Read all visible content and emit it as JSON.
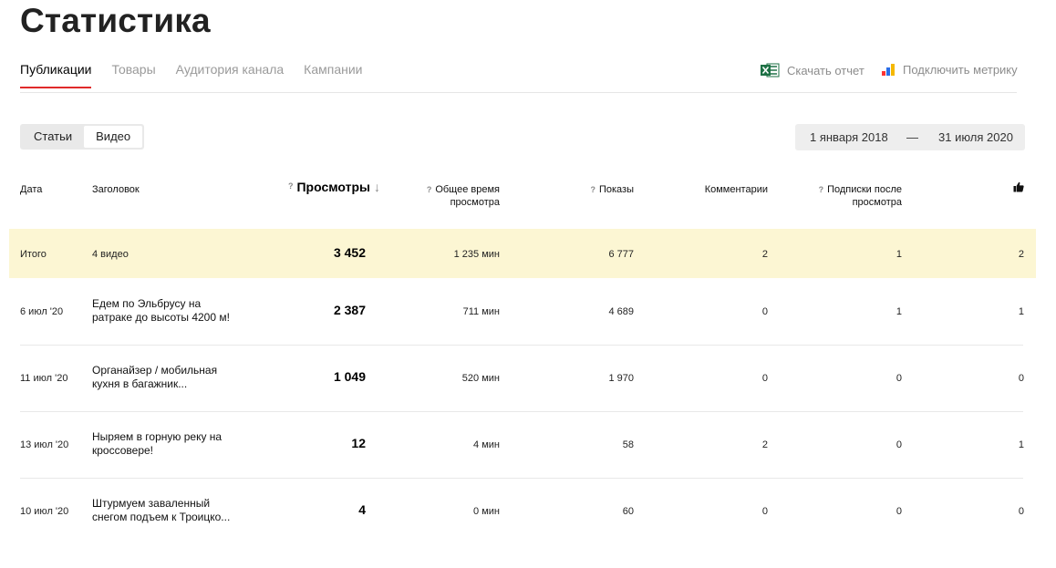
{
  "page_title": "Статистика",
  "tabs": [
    {
      "label": "Публикации"
    },
    {
      "label": "Товары"
    },
    {
      "label": "Аудитория канала"
    },
    {
      "label": "Кампании"
    }
  ],
  "toolbar": {
    "download_label": "Скачать отчет",
    "metrika_label": "Подключить метрику"
  },
  "segment": {
    "articles": "Статьи",
    "videos": "Видео"
  },
  "daterange": {
    "from": "1 января 2018",
    "separator": "—",
    "to": "31 июля 2020"
  },
  "table": {
    "headers": {
      "date": "Дата",
      "title": "Заголовок",
      "views": "Просмотры",
      "watch_time_1": "Общее время",
      "watch_time_2": "просмотра",
      "impressions": "Показы",
      "comments": "Комментарии",
      "subs_1": "Подписки после",
      "subs_2": "просмотра",
      "help_mark": "?",
      "sort_arrow": "↓"
    },
    "total": {
      "date": "Итого",
      "title": "4 видео",
      "views": "3 452",
      "time": "1 235 мин",
      "impressions": "6 777",
      "comments": "2",
      "subs": "1",
      "likes": "2"
    },
    "rows": [
      {
        "date": "6 июл '20",
        "title": "Едем по Эльбрусу на ратраке до высоты 4200 м!",
        "views": "2 387",
        "time": "711 мин",
        "impressions": "4 689",
        "comments": "0",
        "subs": "1",
        "likes": "1"
      },
      {
        "date": "11 июл '20",
        "title": "Органайзер / мобильная кухня в багажник...",
        "views": "1 049",
        "time": "520 мин",
        "impressions": "1 970",
        "comments": "0",
        "subs": "0",
        "likes": "0"
      },
      {
        "date": "13 июл '20",
        "title": "Ныряем в горную реку на кроссовере!",
        "views": "12",
        "time": "4 мин",
        "impressions": "58",
        "comments": "2",
        "subs": "0",
        "likes": "1"
      },
      {
        "date": "10 июл '20",
        "title": "Штурмуем заваленный снегом подъем к Троицко...",
        "views": "4",
        "time": "0 мин",
        "impressions": "60",
        "comments": "0",
        "subs": "0",
        "likes": "0"
      }
    ]
  },
  "colors": {
    "accent": "#e02a2a",
    "total_bg": "#fcf6d3",
    "excel_green": "#1e7145"
  },
  "icons": {
    "excel": "excel-icon",
    "metrika": "metrika-icon",
    "likes": "thumbs-up-icon",
    "help": "help-icon",
    "sort": "sort-arrow-icon"
  }
}
